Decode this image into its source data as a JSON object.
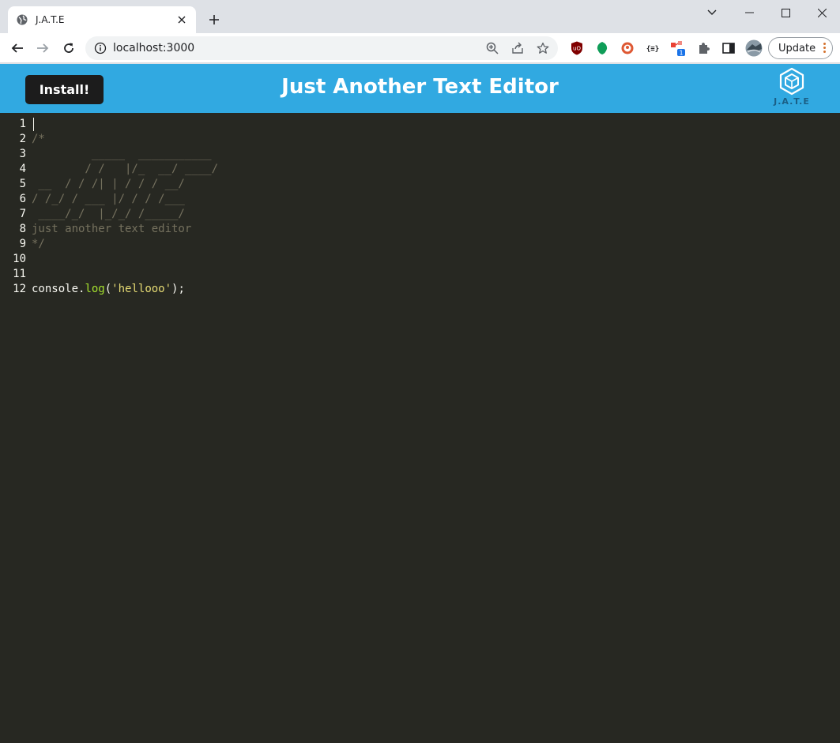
{
  "browser": {
    "tab_title": "J.A.T.E",
    "url": "localhost:3000",
    "update_label": "Update",
    "ext_badge": "1"
  },
  "app": {
    "install_label": "Install!",
    "title": "Just Another Text Editor",
    "logo_text": "J.A.T.E"
  },
  "editor": {
    "lines": [
      {
        "num": "1",
        "tokens": []
      },
      {
        "num": "2",
        "tokens": [
          {
            "t": "/*",
            "c": "comment"
          }
        ]
      },
      {
        "num": "3",
        "tokens": [
          {
            "t": "         _____  ___________",
            "c": "comment"
          }
        ]
      },
      {
        "num": "4",
        "tokens": [
          {
            "t": "        / /   |/_  __/ ____/",
            "c": "comment"
          }
        ]
      },
      {
        "num": "5",
        "tokens": [
          {
            "t": " __  / / /| | / / / __/",
            "c": "comment"
          }
        ]
      },
      {
        "num": "6",
        "tokens": [
          {
            "t": "/ /_/ / ___ |/ / / /___",
            "c": "comment"
          }
        ]
      },
      {
        "num": "7",
        "tokens": [
          {
            "t": " ____/_/  |_/_/ /_____/",
            "c": "comment"
          }
        ]
      },
      {
        "num": "8",
        "tokens": [
          {
            "t": "just another text editor",
            "c": "comment"
          }
        ]
      },
      {
        "num": "9",
        "tokens": [
          {
            "t": "*/",
            "c": "comment"
          }
        ]
      },
      {
        "num": "10",
        "tokens": []
      },
      {
        "num": "11",
        "tokens": []
      },
      {
        "num": "12",
        "tokens": [
          {
            "t": "console.",
            "c": "plain"
          },
          {
            "t": "log",
            "c": "prop"
          },
          {
            "t": "(",
            "c": "plain"
          },
          {
            "t": "'hellooo'",
            "c": "string"
          },
          {
            "t": ");",
            "c": "plain"
          }
        ]
      }
    ]
  }
}
